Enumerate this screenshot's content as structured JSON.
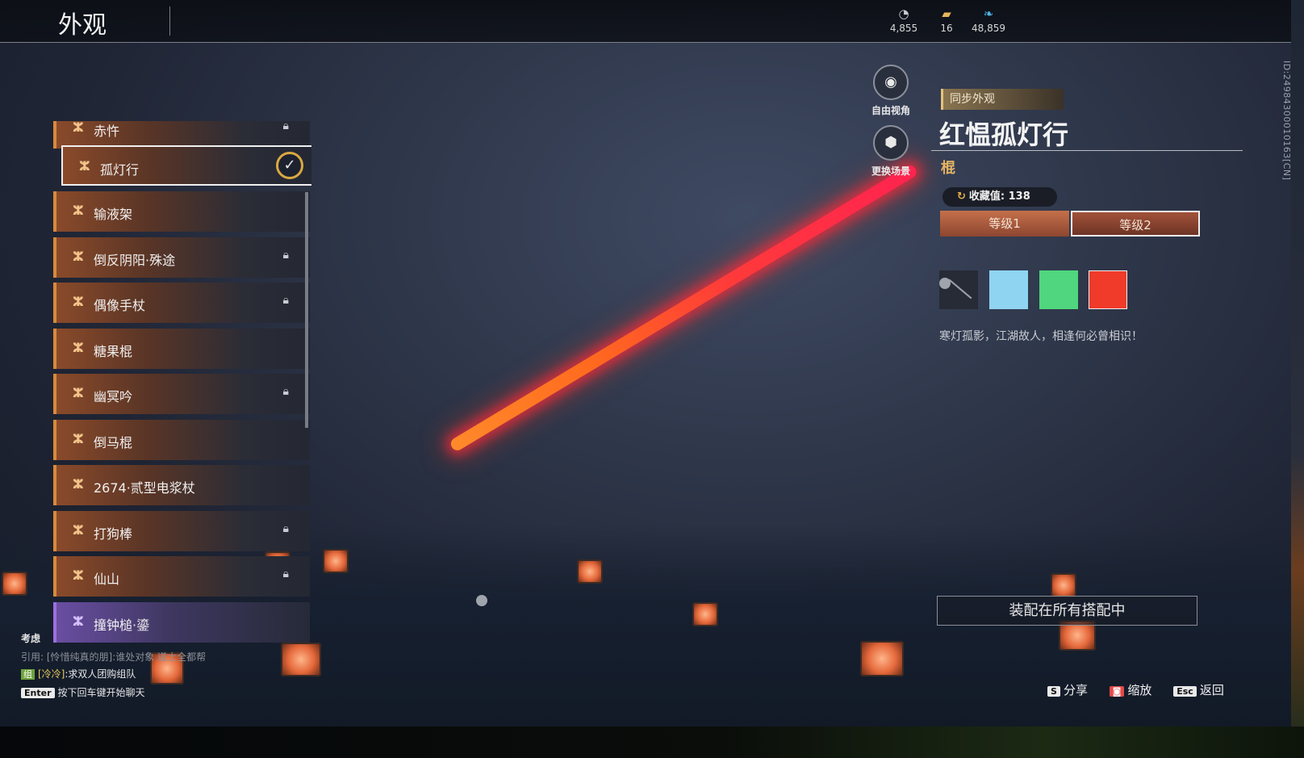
{
  "header": {
    "title": "外观",
    "currencies": [
      {
        "icon": "silver-coin-icon",
        "glyph": "◔",
        "value": "4,855"
      },
      {
        "icon": "gold-ingot-icon",
        "glyph": "▰",
        "value": "16"
      },
      {
        "icon": "feather-icon",
        "glyph": "❧",
        "value": "48,859"
      }
    ]
  },
  "id_text": "ID:24984300010163[CN]",
  "list": {
    "items": [
      {
        "label": "赤忤",
        "locked": true
      },
      {
        "label": "孤灯行",
        "selected": true
      },
      {
        "label": "输液架"
      },
      {
        "label": "倒反阴阳·殊途",
        "locked": true
      },
      {
        "label": "偶像手杖",
        "locked": true
      },
      {
        "label": "糖果棍"
      },
      {
        "label": "幽冥吟",
        "locked": true
      },
      {
        "label": "倒马棍"
      },
      {
        "label": "2674·贰型电浆杖"
      },
      {
        "label": "打狗棒",
        "locked": true
      },
      {
        "label": "仙山",
        "locked": true
      },
      {
        "label": "撞钟槌·鎏",
        "rarity": "purple"
      }
    ]
  },
  "tools": {
    "free_view": "自由视角",
    "change_scene": "更换场景"
  },
  "detail": {
    "sync_tag": "同步外观",
    "name": "红愠孤灯行",
    "type": "棍",
    "collection_label": "收藏值: 138",
    "levels": [
      "等级1",
      "等级2"
    ],
    "active_level": 1,
    "swatches": [
      "default",
      "#8fd4f0",
      "#4fd67e",
      "#f03b2a"
    ],
    "description": "寒灯孤影，江湖故人，相逢何必曾相识！",
    "equip_all": "装配在所有搭配中"
  },
  "chat": {
    "channel": "考虑",
    "quote": "引用: [怜惜纯真的朋]:谁处对象 道士全都帮",
    "badge": "组",
    "sender": "[冷冷]",
    "message": ":求双人团购组队",
    "hint_key": "Enter",
    "hint": "按下回车键开始聊天"
  },
  "footer": {
    "share_key": "S",
    "share": "分享",
    "zoom_key": "◙",
    "zoom": "缩放",
    "back_key": "Esc",
    "back": "返回"
  }
}
